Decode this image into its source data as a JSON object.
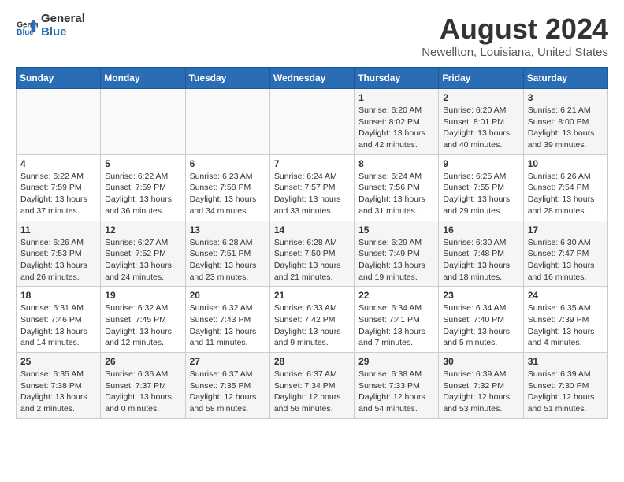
{
  "header": {
    "logo_line1": "General",
    "logo_line2": "Blue",
    "title": "August 2024",
    "subtitle": "Newellton, Louisiana, United States"
  },
  "calendar": {
    "days_of_week": [
      "Sunday",
      "Monday",
      "Tuesday",
      "Wednesday",
      "Thursday",
      "Friday",
      "Saturday"
    ],
    "weeks": [
      [
        {
          "day": "",
          "info": ""
        },
        {
          "day": "",
          "info": ""
        },
        {
          "day": "",
          "info": ""
        },
        {
          "day": "",
          "info": ""
        },
        {
          "day": "1",
          "info": "Sunrise: 6:20 AM\nSunset: 8:02 PM\nDaylight: 13 hours\nand 42 minutes."
        },
        {
          "day": "2",
          "info": "Sunrise: 6:20 AM\nSunset: 8:01 PM\nDaylight: 13 hours\nand 40 minutes."
        },
        {
          "day": "3",
          "info": "Sunrise: 6:21 AM\nSunset: 8:00 PM\nDaylight: 13 hours\nand 39 minutes."
        }
      ],
      [
        {
          "day": "4",
          "info": "Sunrise: 6:22 AM\nSunset: 7:59 PM\nDaylight: 13 hours\nand 37 minutes."
        },
        {
          "day": "5",
          "info": "Sunrise: 6:22 AM\nSunset: 7:59 PM\nDaylight: 13 hours\nand 36 minutes."
        },
        {
          "day": "6",
          "info": "Sunrise: 6:23 AM\nSunset: 7:58 PM\nDaylight: 13 hours\nand 34 minutes."
        },
        {
          "day": "7",
          "info": "Sunrise: 6:24 AM\nSunset: 7:57 PM\nDaylight: 13 hours\nand 33 minutes."
        },
        {
          "day": "8",
          "info": "Sunrise: 6:24 AM\nSunset: 7:56 PM\nDaylight: 13 hours\nand 31 minutes."
        },
        {
          "day": "9",
          "info": "Sunrise: 6:25 AM\nSunset: 7:55 PM\nDaylight: 13 hours\nand 29 minutes."
        },
        {
          "day": "10",
          "info": "Sunrise: 6:26 AM\nSunset: 7:54 PM\nDaylight: 13 hours\nand 28 minutes."
        }
      ],
      [
        {
          "day": "11",
          "info": "Sunrise: 6:26 AM\nSunset: 7:53 PM\nDaylight: 13 hours\nand 26 minutes."
        },
        {
          "day": "12",
          "info": "Sunrise: 6:27 AM\nSunset: 7:52 PM\nDaylight: 13 hours\nand 24 minutes."
        },
        {
          "day": "13",
          "info": "Sunrise: 6:28 AM\nSunset: 7:51 PM\nDaylight: 13 hours\nand 23 minutes."
        },
        {
          "day": "14",
          "info": "Sunrise: 6:28 AM\nSunset: 7:50 PM\nDaylight: 13 hours\nand 21 minutes."
        },
        {
          "day": "15",
          "info": "Sunrise: 6:29 AM\nSunset: 7:49 PM\nDaylight: 13 hours\nand 19 minutes."
        },
        {
          "day": "16",
          "info": "Sunrise: 6:30 AM\nSunset: 7:48 PM\nDaylight: 13 hours\nand 18 minutes."
        },
        {
          "day": "17",
          "info": "Sunrise: 6:30 AM\nSunset: 7:47 PM\nDaylight: 13 hours\nand 16 minutes."
        }
      ],
      [
        {
          "day": "18",
          "info": "Sunrise: 6:31 AM\nSunset: 7:46 PM\nDaylight: 13 hours\nand 14 minutes."
        },
        {
          "day": "19",
          "info": "Sunrise: 6:32 AM\nSunset: 7:45 PM\nDaylight: 13 hours\nand 12 minutes."
        },
        {
          "day": "20",
          "info": "Sunrise: 6:32 AM\nSunset: 7:43 PM\nDaylight: 13 hours\nand 11 minutes."
        },
        {
          "day": "21",
          "info": "Sunrise: 6:33 AM\nSunset: 7:42 PM\nDaylight: 13 hours\nand 9 minutes."
        },
        {
          "day": "22",
          "info": "Sunrise: 6:34 AM\nSunset: 7:41 PM\nDaylight: 13 hours\nand 7 minutes."
        },
        {
          "day": "23",
          "info": "Sunrise: 6:34 AM\nSunset: 7:40 PM\nDaylight: 13 hours\nand 5 minutes."
        },
        {
          "day": "24",
          "info": "Sunrise: 6:35 AM\nSunset: 7:39 PM\nDaylight: 13 hours\nand 4 minutes."
        }
      ],
      [
        {
          "day": "25",
          "info": "Sunrise: 6:35 AM\nSunset: 7:38 PM\nDaylight: 13 hours\nand 2 minutes."
        },
        {
          "day": "26",
          "info": "Sunrise: 6:36 AM\nSunset: 7:37 PM\nDaylight: 13 hours\nand 0 minutes."
        },
        {
          "day": "27",
          "info": "Sunrise: 6:37 AM\nSunset: 7:35 PM\nDaylight: 12 hours\nand 58 minutes."
        },
        {
          "day": "28",
          "info": "Sunrise: 6:37 AM\nSunset: 7:34 PM\nDaylight: 12 hours\nand 56 minutes."
        },
        {
          "day": "29",
          "info": "Sunrise: 6:38 AM\nSunset: 7:33 PM\nDaylight: 12 hours\nand 54 minutes."
        },
        {
          "day": "30",
          "info": "Sunrise: 6:39 AM\nSunset: 7:32 PM\nDaylight: 12 hours\nand 53 minutes."
        },
        {
          "day": "31",
          "info": "Sunrise: 6:39 AM\nSunset: 7:30 PM\nDaylight: 12 hours\nand 51 minutes."
        }
      ]
    ]
  }
}
